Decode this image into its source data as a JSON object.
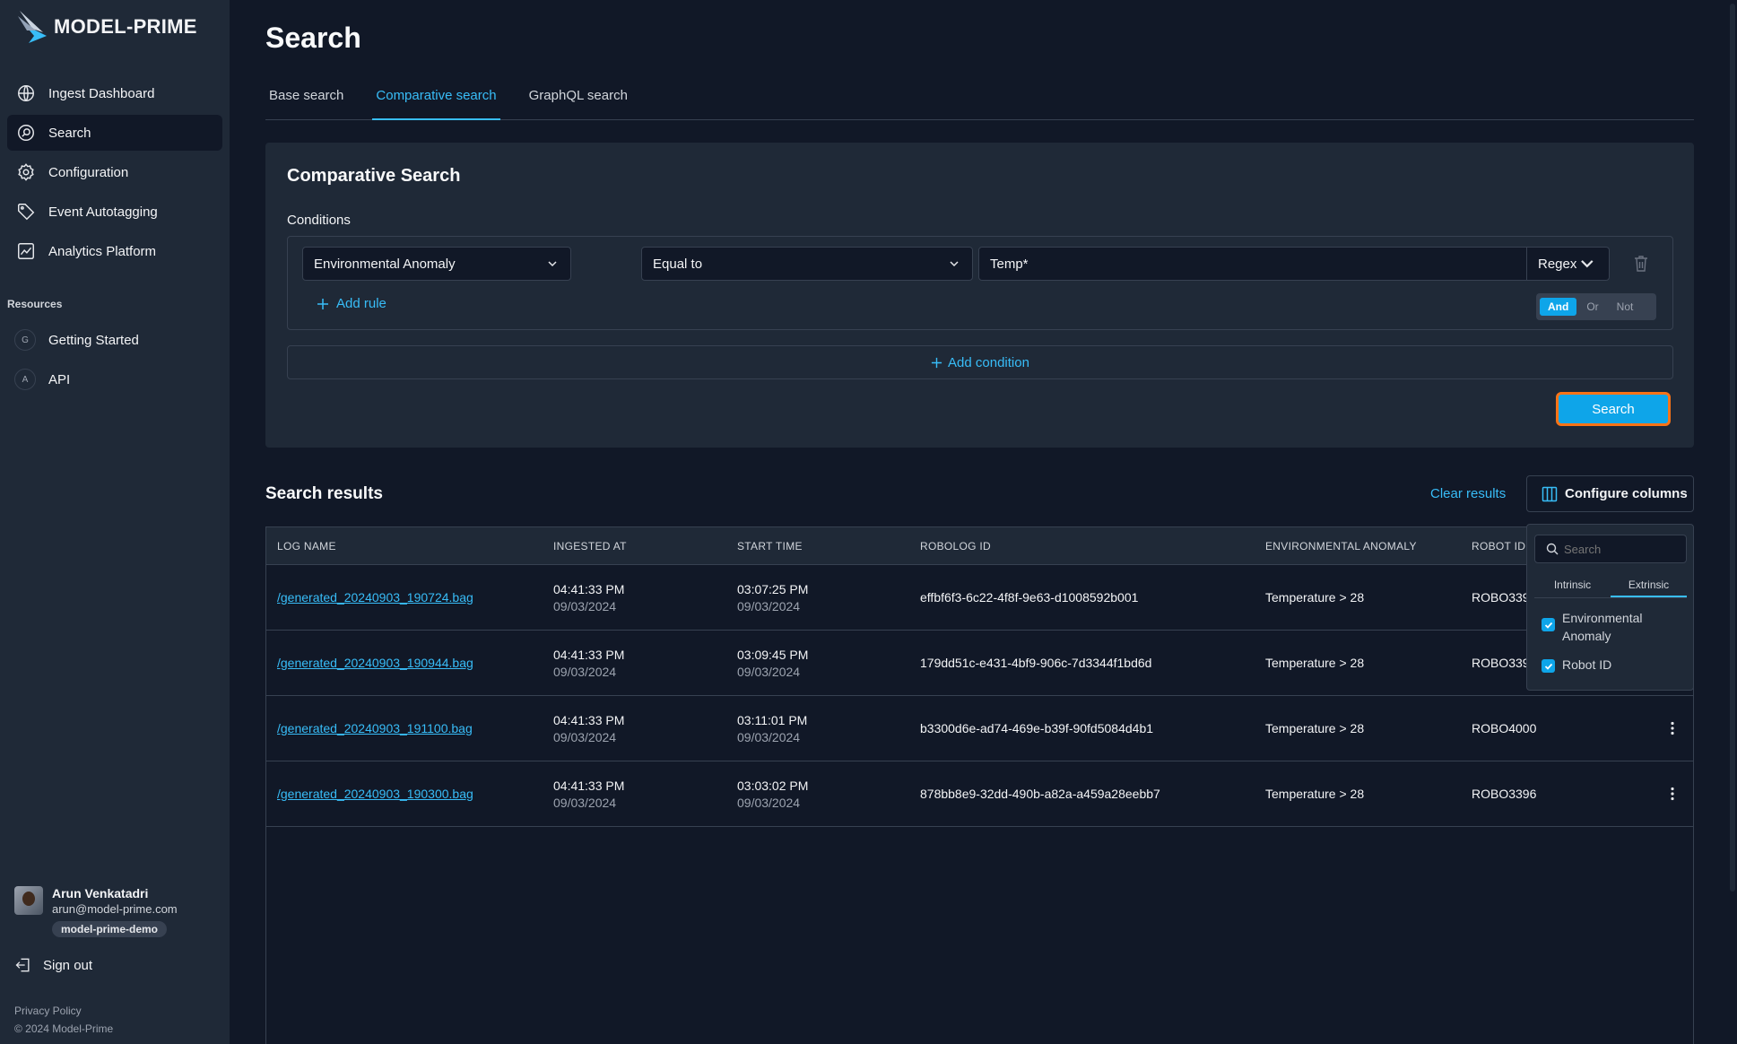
{
  "app": {
    "logo_text": "MODEL-PRIME"
  },
  "sidebar": {
    "items": [
      {
        "label": "Ingest Dashboard",
        "icon": "globe-icon"
      },
      {
        "label": "Search",
        "icon": "search-icon",
        "active": true
      },
      {
        "label": "Configuration",
        "icon": "gear-icon"
      },
      {
        "label": "Event Autotagging",
        "icon": "tag-icon"
      },
      {
        "label": "Analytics Platform",
        "icon": "chart-icon"
      }
    ],
    "resources_label": "Resources",
    "resources": [
      {
        "badge": "G",
        "label": "Getting Started"
      },
      {
        "badge": "A",
        "label": "API"
      }
    ]
  },
  "user": {
    "name": "Arun Venkatadri",
    "email": "arun@model-prime.com",
    "org": "model-prime-demo",
    "signout": "Sign out"
  },
  "footer": {
    "privacy": "Privacy Policy",
    "copyright": "© 2024 Model-Prime"
  },
  "page": {
    "title": "Search",
    "tabs": [
      {
        "label": "Base search"
      },
      {
        "label": "Comparative search",
        "active": true
      },
      {
        "label": "GraphQL search"
      }
    ]
  },
  "comparative": {
    "title": "Comparative Search",
    "conditions_label": "Conditions",
    "field_select": "Environmental Anomaly",
    "operator_select": "Equal to",
    "value": "Temp*",
    "mode": "Regex",
    "add_rule": "Add rule",
    "logic": [
      "And",
      "Or",
      "Not"
    ],
    "logic_selected": "And",
    "add_condition": "Add condition",
    "search_button": "Search"
  },
  "results": {
    "title": "Search results",
    "clear": "Clear results",
    "configure": "Configure columns",
    "columns": [
      "LOG NAME",
      "INGESTED AT",
      "START TIME",
      "ROBOLOG ID",
      "ENVIRONMENTAL ANOMALY",
      "ROBOT ID"
    ],
    "rows": [
      {
        "log": "/generated_20240903_190724.bag",
        "ing_t": "04:41:33 PM",
        "ing_d": "09/03/2024",
        "st_t": "03:07:25 PM",
        "st_d": "09/03/2024",
        "id": "effbf6f3-6c22-4f8f-9e63-d1008592b001",
        "anomaly": "Temperature > 28",
        "robot": "ROBO339"
      },
      {
        "log": "/generated_20240903_190944.bag",
        "ing_t": "04:41:33 PM",
        "ing_d": "09/03/2024",
        "st_t": "03:09:45 PM",
        "st_d": "09/03/2024",
        "id": "179dd51c-e431-4bf9-906c-7d3344f1bd6d",
        "anomaly": "Temperature > 28",
        "robot": "ROBO339"
      },
      {
        "log": "/generated_20240903_191100.bag",
        "ing_t": "04:41:33 PM",
        "ing_d": "09/03/2024",
        "st_t": "03:11:01 PM",
        "st_d": "09/03/2024",
        "id": "b3300d6e-ad74-469e-b39f-90fd5084d4b1",
        "anomaly": "Temperature > 28",
        "robot": "ROBO4000"
      },
      {
        "log": "/generated_20240903_190300.bag",
        "ing_t": "04:41:33 PM",
        "ing_d": "09/03/2024",
        "st_t": "03:03:02 PM",
        "st_d": "09/03/2024",
        "id": "878bb8e9-32dd-490b-a82a-a459a28eebb7",
        "anomaly": "Temperature > 28",
        "robot": "ROBO3396"
      }
    ]
  },
  "column_popup": {
    "search_placeholder": "Search",
    "tabs": [
      "Intrinsic",
      "Extrinsic"
    ],
    "active_tab": "Extrinsic",
    "items": [
      "Environmental",
      "Anomaly",
      "Robot ID"
    ]
  },
  "colors": {
    "accent": "#0ea5e9",
    "link": "#38bdf8",
    "focus": "#f97316",
    "bg": "#111827",
    "panel": "#1f2937"
  }
}
